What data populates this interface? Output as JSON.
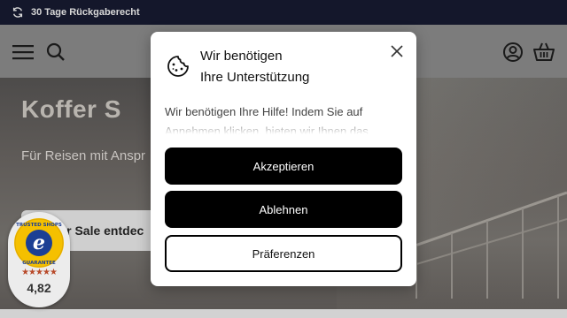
{
  "topbar": {
    "text": "30 Tage Rückgaberecht",
    "icon": "refresh-icon"
  },
  "header": {
    "icons": [
      "menu-icon",
      "search-icon",
      "account-icon",
      "basket-icon"
    ]
  },
  "hero": {
    "title": "Koffer S",
    "subtitle": "Für Reisen mit Anspr",
    "button_label": "ffer Sale entdec"
  },
  "trust_badge": {
    "seal_top_text": "TRUSTED SHOPS",
    "seal_bottom_text": "GUARANTEE",
    "seal_letter": "e",
    "stars": "★★★★★",
    "rating": "4,82"
  },
  "cookie_modal": {
    "title_line1": "Wir benötigen",
    "title_line2": "Ihre Unterstützung",
    "body": "Wir benötigen Ihre Hilfe! Indem Sie auf Annehmen klicken, bieten wir Ihnen das",
    "accept_label": "Akzeptieren",
    "decline_label": "Ablehnen",
    "preferences_label": "Präferenzen"
  },
  "colors": {
    "topbar_bg": "#14172b",
    "button_primary": "#000000",
    "star_color": "#b84a2a",
    "seal_blue": "#1c3f94",
    "seal_yellow": "#f5c000"
  }
}
